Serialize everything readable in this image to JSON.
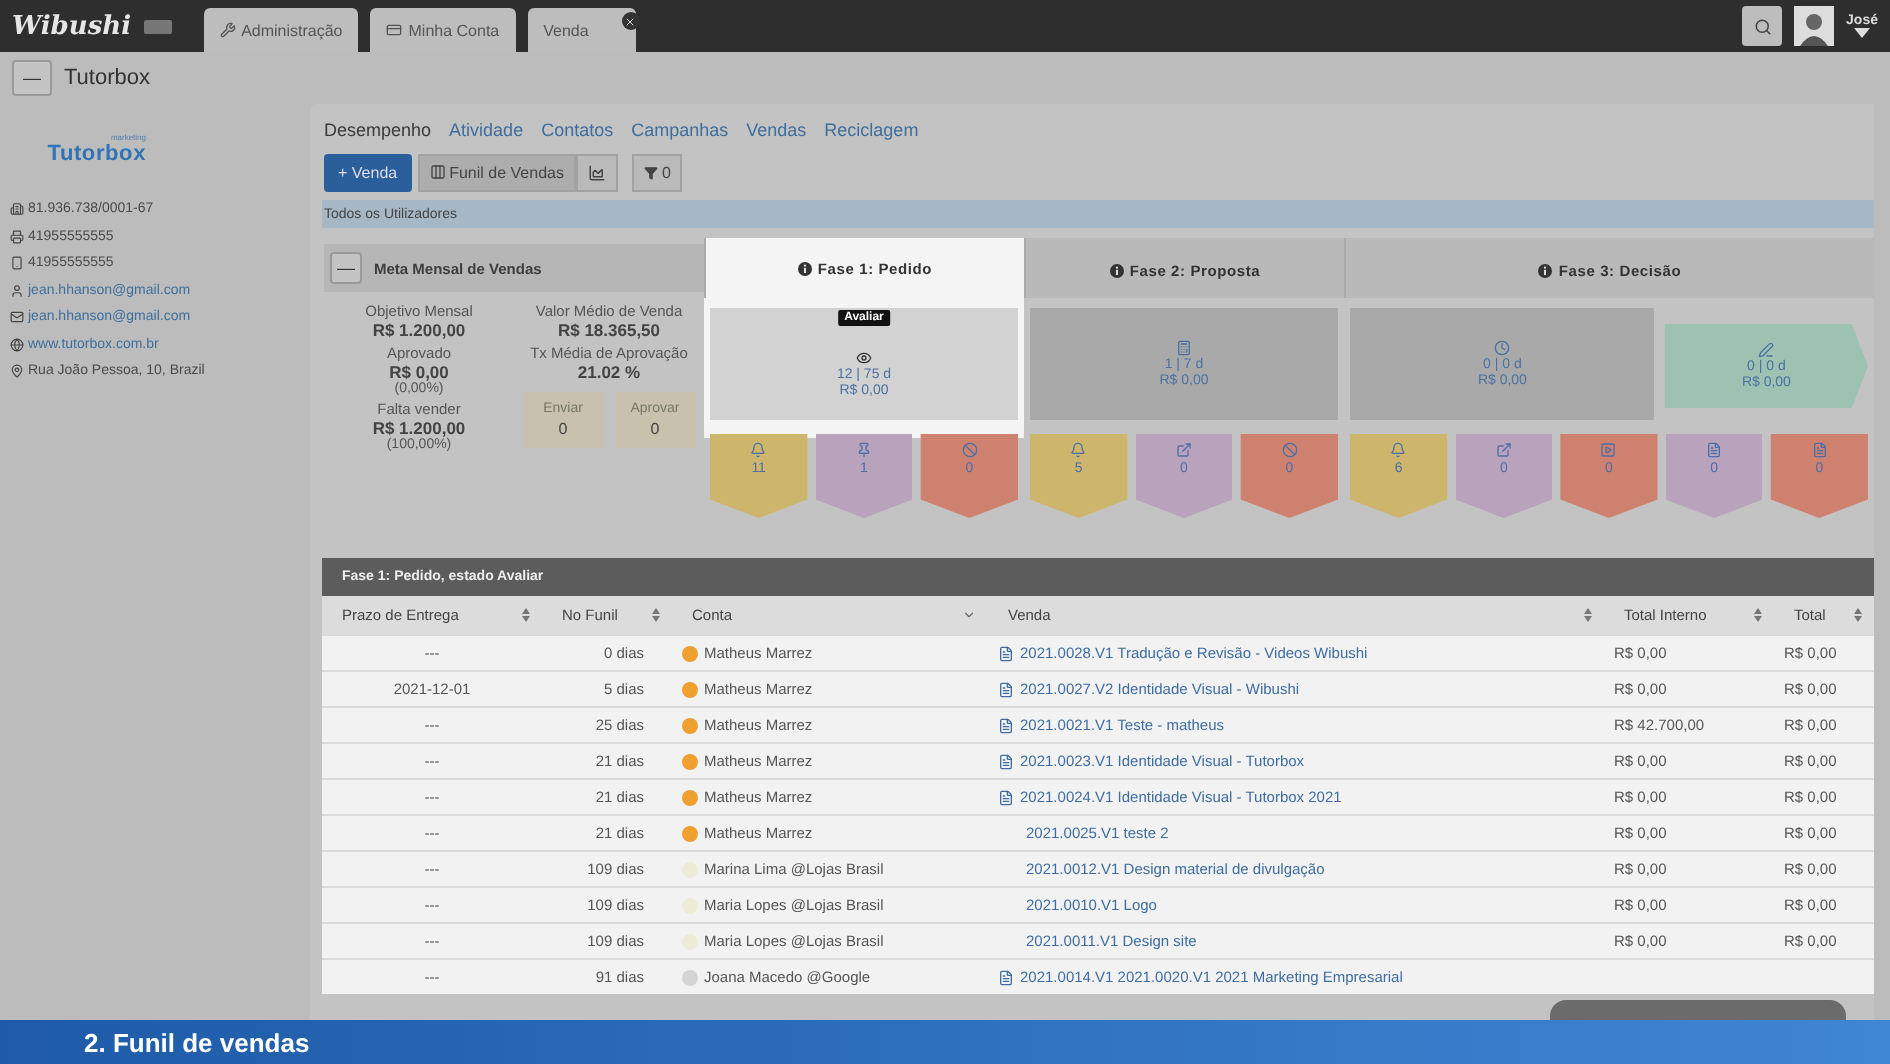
{
  "app": {
    "logo": "Wibushi",
    "tabs": [
      {
        "label": "Administração",
        "closable": false
      },
      {
        "label": "Minha Conta",
        "closable": false
      },
      {
        "label": "Venda",
        "closable": true
      }
    ],
    "user": "José"
  },
  "account": {
    "collapse": "—",
    "title": "Tutorbox",
    "logo": "Tutorbox",
    "logo_tag": "marketing",
    "contacts": [
      {
        "kind": "company",
        "text": "81.936.738/0001-67"
      },
      {
        "kind": "fax",
        "text": "41955555555"
      },
      {
        "kind": "mobile",
        "text": "41955555555"
      },
      {
        "kind": "person",
        "text": "jean.hhanson@gmail.com"
      },
      {
        "kind": "email",
        "text": "jean.hhanson@gmail.com"
      },
      {
        "kind": "web",
        "text": "www.tutorbox.com.br"
      },
      {
        "kind": "address",
        "text": "Rua João Pessoa, 10, Brazil"
      }
    ]
  },
  "nav": [
    {
      "label": "Desempenho",
      "selected": true
    },
    {
      "label": "Atividade",
      "selected": false
    },
    {
      "label": "Contatos",
      "selected": false
    },
    {
      "label": "Campanhas",
      "selected": false
    },
    {
      "label": "Vendas",
      "selected": false
    },
    {
      "label": "Reciclagem",
      "selected": false
    }
  ],
  "toolbar": {
    "new": "+ Venda",
    "view": "Funil de Vendas",
    "filter": "0"
  },
  "users_bar": "Todos os Utilizadores",
  "meta": {
    "collapse": "—",
    "title": "Meta Mensal de Vendas",
    "left": [
      {
        "label": "Objetivo Mensal",
        "value": "R$ 1.200,00"
      },
      {
        "label": "Aprovado",
        "value": "R$ 0,00",
        "note": "(0,00%)"
      },
      {
        "label": "Falta vender",
        "value": "R$ 1.200,00",
        "note": "(100,00%)"
      }
    ],
    "right": [
      {
        "label": "Valor Médio de Venda",
        "value": "R$ 18.365,50"
      },
      {
        "label": "Tx Média de Aprovação",
        "value": "21.02 %"
      }
    ],
    "counters": [
      {
        "label": "Enviar",
        "value": "0"
      },
      {
        "label": "Aprovar",
        "value": "0"
      }
    ]
  },
  "phases": [
    {
      "title": "Fase 1: Pedido",
      "highlighted": true,
      "stages": [
        {
          "count": "12 | 75 d",
          "value": "R$ 0,00",
          "tooltip": "Avaliar",
          "color": "#d2d2d2"
        }
      ],
      "tags": [
        {
          "value": "11",
          "color": "#cdb66c"
        },
        {
          "value": "1",
          "color": "#b9a2bc"
        },
        {
          "value": "0",
          "color": "#cf816f"
        }
      ]
    },
    {
      "title": "Fase 2: Proposta",
      "highlighted": false,
      "stages": [
        {
          "count": "1 | 7 d",
          "value": "R$ 0,00",
          "color": "#a9a9a9"
        }
      ],
      "tags": [
        {
          "value": "5",
          "color": "#cdb66c"
        },
        {
          "value": "0",
          "color": "#b9a2bc"
        },
        {
          "value": "0",
          "color": "#cf816f"
        }
      ]
    },
    {
      "title": "Fase 3: Decisão",
      "highlighted": false,
      "stages": [
        {
          "count": "0 | 0 d",
          "value": "R$ 0,00",
          "color": "#a9a9a9"
        },
        {
          "count": "0 | 0 d",
          "value": "R$ 0,00",
          "color": "#9dc2b2"
        }
      ],
      "tags": [
        {
          "value": "6",
          "color": "#cdb66c"
        },
        {
          "value": "0",
          "color": "#b9a2bc"
        },
        {
          "value": "0",
          "color": "#cf816f"
        },
        {
          "value": "0",
          "color": "#b9a2bc"
        },
        {
          "value": "0",
          "color": "#cf816f"
        }
      ]
    }
  ],
  "table": {
    "title": "Fase 1: Pedido, estado Avaliar",
    "columns": [
      "Prazo de Entrega",
      "No Funil",
      "Conta",
      "Venda",
      "Total Interno",
      "Total"
    ],
    "rows": [
      {
        "prazo": "---",
        "funil": "0 dias",
        "conta": "Matheus Marrez",
        "color": "#f0a030",
        "venda": "2021.0028.V1 Tradução e Revisão - Videos Wibushi",
        "attachment": true,
        "interno": "R$ 0,00",
        "total": "R$ 0,00"
      },
      {
        "prazo": "2021-12-01",
        "funil": "5 dias",
        "conta": "Matheus Marrez",
        "color": "#f0a030",
        "venda": "2021.0027.V2 Identidade Visual - Wibushi",
        "attachment": true,
        "interno": "R$ 0,00",
        "total": "R$ 0,00"
      },
      {
        "prazo": "---",
        "funil": "25 dias",
        "conta": "Matheus Marrez",
        "color": "#f0a030",
        "venda": "2021.0021.V1 Teste - matheus",
        "attachment": true,
        "interno": "R$ 42.700,00",
        "total": "R$ 0,00"
      },
      {
        "prazo": "---",
        "funil": "21 dias",
        "conta": "Matheus Marrez",
        "color": "#f0a030",
        "venda": "2021.0023.V1 Identidade Visual - Tutorbox",
        "attachment": true,
        "interno": "R$ 0,00",
        "total": "R$ 0,00"
      },
      {
        "prazo": "---",
        "funil": "21 dias",
        "conta": "Matheus Marrez",
        "color": "#f0a030",
        "venda": "2021.0024.V1 Identidade Visual - Tutorbox 2021",
        "attachment": true,
        "interno": "R$ 0,00",
        "total": "R$ 0,00"
      },
      {
        "prazo": "---",
        "funil": "21 dias",
        "conta": "Matheus Marrez",
        "color": "#f0a030",
        "venda": "2021.0025.V1 teste 2",
        "attachment": false,
        "interno": "R$ 0,00",
        "total": "R$ 0,00"
      },
      {
        "prazo": "---",
        "funil": "109 dias",
        "conta": "Marina Lima @Lojas Brasil",
        "color": "#ecebd6",
        "venda": "2021.0012.V1 Design material de divulgação",
        "attachment": false,
        "interno": "R$ 0,00",
        "total": "R$ 0,00"
      },
      {
        "prazo": "---",
        "funil": "109 dias",
        "conta": "Maria Lopes @Lojas Brasil",
        "color": "#ecebd6",
        "venda": "2021.0010.V1 Logo",
        "attachment": false,
        "interno": "R$ 0,00",
        "total": "R$ 0,00"
      },
      {
        "prazo": "---",
        "funil": "109 dias",
        "conta": "Maria Lopes @Lojas Brasil",
        "color": "#ecebd6",
        "venda": "2021.0011.V1 Design site",
        "attachment": false,
        "interno": "R$ 0,00",
        "total": "R$ 0,00"
      },
      {
        "prazo": "---",
        "funil": "91 dias",
        "conta": "Joana Macedo @Google",
        "color": "#d4d4d4",
        "venda": "2021.0014.V1 2021.0020.V1 2021 Marketing Empresarial",
        "attachment": true,
        "interno": "",
        "total": ""
      }
    ]
  },
  "caption": "2. Funil de vendas"
}
